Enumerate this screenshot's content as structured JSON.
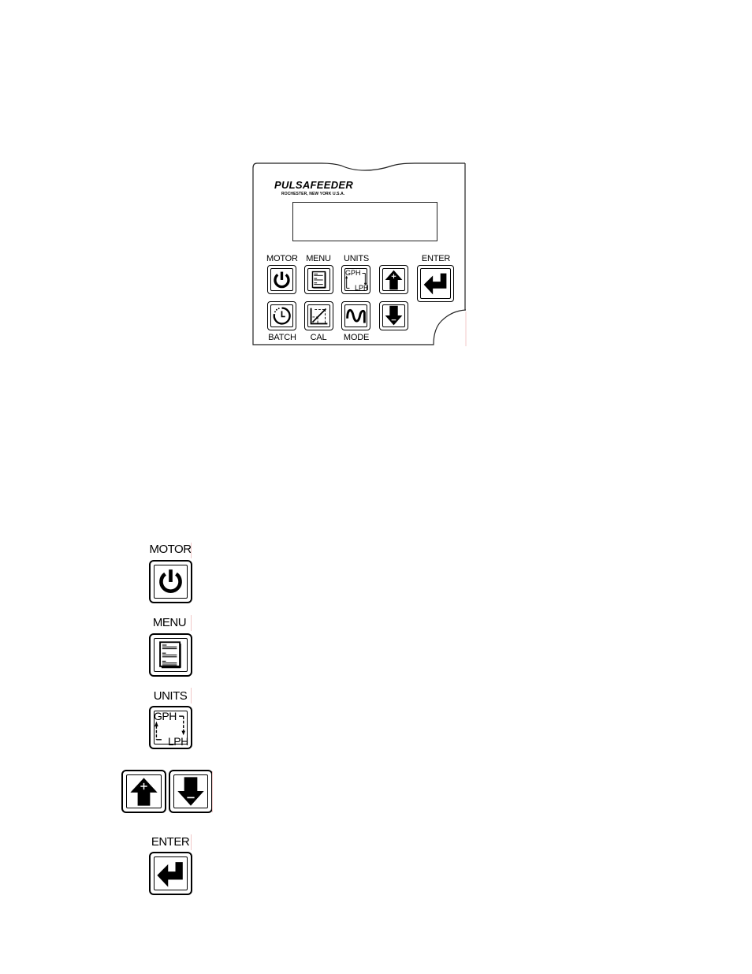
{
  "panel": {
    "brand": "PULSAFEEDER",
    "brand_location": "ROCHESTER, NEW YORK  U.S.A.",
    "display_text": "",
    "keys": {
      "motor": {
        "label": "MOTOR",
        "icon": "power-icon"
      },
      "menu": {
        "label": "MENU",
        "icon": "menu-document-icon"
      },
      "units": {
        "label": "UNITS",
        "icon": "units-toggle-icon",
        "top_text": "GPH",
        "bottom_text": "LPH"
      },
      "up": {
        "label": "",
        "icon": "up-arrow-plus-icon",
        "sign": "+"
      },
      "enter": {
        "label": "ENTER",
        "icon": "enter-return-icon"
      },
      "batch": {
        "label": "BATCH",
        "icon": "clock-timer-icon"
      },
      "cal": {
        "label": "CAL",
        "icon": "calibration-graph-icon"
      },
      "mode": {
        "label": "MODE",
        "icon": "sine-wave-icon"
      },
      "down": {
        "label": "",
        "icon": "down-arrow-minus-icon",
        "sign": "−"
      }
    }
  },
  "legend": {
    "motor": {
      "label": "MOTOR"
    },
    "menu": {
      "label": "MENU"
    },
    "units": {
      "label": "UNITS",
      "top_text": "GPH",
      "bottom_text": "LPH"
    },
    "arrows": {
      "up_sign": "+",
      "down_sign": "−"
    },
    "enter": {
      "label": "ENTER"
    }
  }
}
